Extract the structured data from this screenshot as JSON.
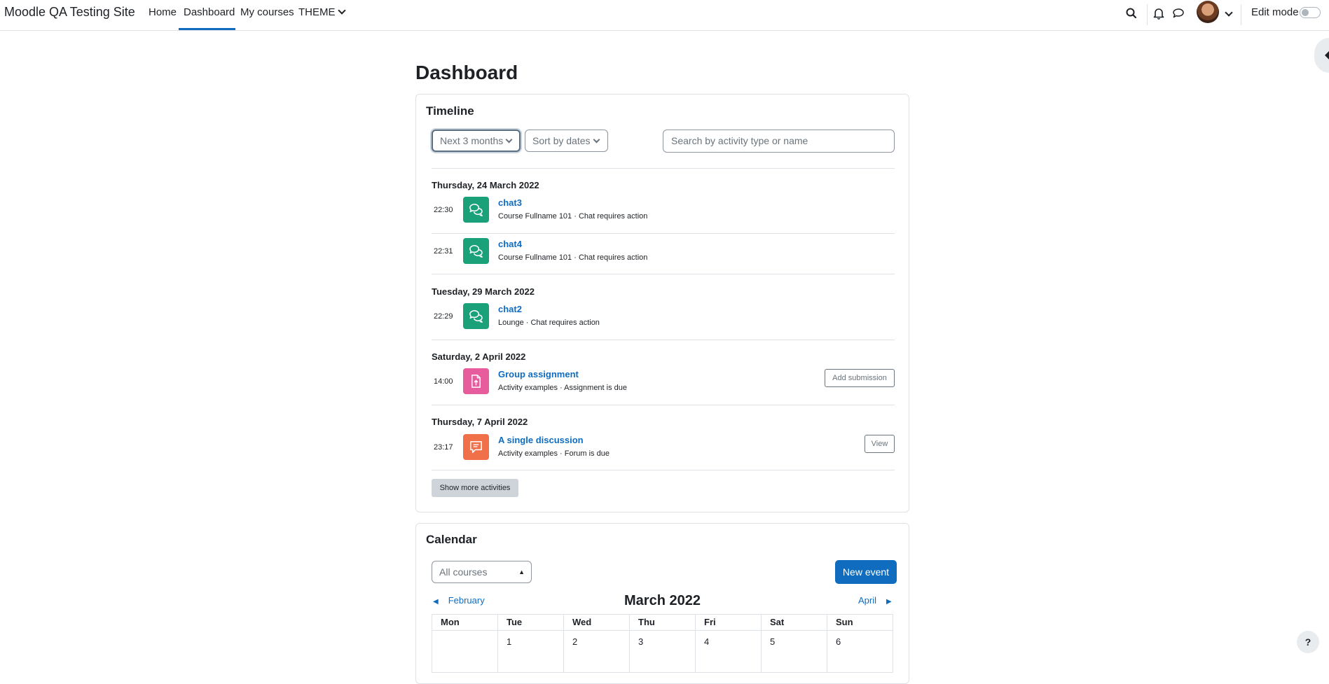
{
  "navbar": {
    "brand": "Moodle QA Testing Site",
    "links": [
      "Home",
      "Dashboard",
      "My courses",
      "THEME"
    ],
    "edit_mode_label": "Edit mode"
  },
  "page": {
    "title": "Dashboard"
  },
  "timeline": {
    "title": "Timeline",
    "filter_label": "Next 3 months",
    "sort_label": "Sort by dates",
    "search_placeholder": "Search by activity type or name",
    "groups": [
      {
        "date": "Thursday, 24 March 2022",
        "events": [
          {
            "time": "22:30",
            "name": "chat3",
            "meta": "Course Fullname 101 · Chat requires action",
            "icon": "chat-icon",
            "color": "#1aa179"
          },
          {
            "time": "22:31",
            "name": "chat4",
            "meta": "Course Fullname 101 · Chat requires action",
            "icon": "chat-icon",
            "color": "#1aa179"
          }
        ]
      },
      {
        "date": "Tuesday, 29 March 2022",
        "events": [
          {
            "time": "22:29",
            "name": "chat2",
            "meta": "Lounge · Chat requires action",
            "icon": "chat-icon",
            "color": "#1aa179"
          }
        ]
      },
      {
        "date": "Saturday, 2 April 2022",
        "events": [
          {
            "time": "14:00",
            "name": "Group assignment",
            "meta": "Activity examples · Assignment is due",
            "icon": "assignment-icon",
            "color": "#e65c9c",
            "action": "Add submission"
          }
        ]
      },
      {
        "date": "Thursday, 7 April 2022",
        "events": [
          {
            "time": "23:17",
            "name": "A single discussion",
            "meta": "Activity examples · Forum is due",
            "icon": "forum-icon",
            "color": "#f0704a",
            "action": "View"
          }
        ]
      }
    ],
    "show_more": "Show more activities"
  },
  "calendar": {
    "title": "Calendar",
    "course_select": "All courses",
    "new_event": "New event",
    "prev_month": "February",
    "next_month": "April",
    "month": "March 2022",
    "weekdays": [
      "Mon",
      "Tue",
      "Wed",
      "Thu",
      "Fri",
      "Sat",
      "Sun"
    ],
    "first_week": [
      "",
      "1",
      "2",
      "3",
      "4",
      "5",
      "6"
    ]
  },
  "help": "?"
}
